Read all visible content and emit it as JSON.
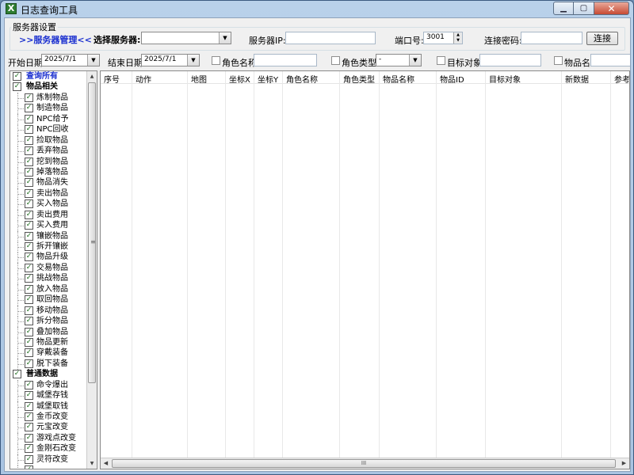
{
  "window": {
    "title": "日志查询工具",
    "min": "▁",
    "max": "▢",
    "close": "✕"
  },
  "server_settings": {
    "group_title": "服务器设置",
    "manage_link": ">>服务器管理<<",
    "select_label": "选择服务器:",
    "ip_label": "服务器IP:",
    "port_label": "端口号:",
    "port_value": "3001",
    "password_label": "连接密码:",
    "connect_button": "连接"
  },
  "filters": {
    "start_label": "开始日期:",
    "start_value": "2025/7/1",
    "end_label": "结束日期:",
    "end_value": "2025/7/1",
    "role_name_label": "角色名称",
    "role_type_label": "角色类型",
    "role_type_value": "-",
    "target_label": "目标对象",
    "item_name_label": "物品名"
  },
  "tree": {
    "items": [
      {
        "label": "查询所有",
        "level": "parent",
        "checked": true,
        "selected": true
      },
      {
        "label": "物品相关",
        "level": "parent",
        "checked": true
      },
      {
        "label": "炼制物品",
        "level": "child",
        "checked": true
      },
      {
        "label": "制造物品",
        "level": "child",
        "checked": true
      },
      {
        "label": "NPC给予",
        "level": "child",
        "checked": true
      },
      {
        "label": "NPC回收",
        "level": "child",
        "checked": true
      },
      {
        "label": "捡取物品",
        "level": "child",
        "checked": true
      },
      {
        "label": "丢弃物品",
        "level": "child",
        "checked": true
      },
      {
        "label": "挖到物品",
        "level": "child",
        "checked": true
      },
      {
        "label": "掉落物品",
        "level": "child",
        "checked": true
      },
      {
        "label": "物品消失",
        "level": "child",
        "checked": true
      },
      {
        "label": "卖出物品",
        "level": "child",
        "checked": true
      },
      {
        "label": "买入物品",
        "level": "child",
        "checked": true
      },
      {
        "label": "卖出费用",
        "level": "child",
        "checked": true
      },
      {
        "label": "买入费用",
        "level": "child",
        "checked": true
      },
      {
        "label": "镶嵌物品",
        "level": "child",
        "checked": true
      },
      {
        "label": "拆开镶嵌",
        "level": "child",
        "checked": true
      },
      {
        "label": "物品升级",
        "level": "child",
        "checked": true
      },
      {
        "label": "交易物品",
        "level": "child",
        "checked": true
      },
      {
        "label": "挑战物品",
        "level": "child",
        "checked": true
      },
      {
        "label": "放入物品",
        "level": "child",
        "checked": true
      },
      {
        "label": "取回物品",
        "level": "child",
        "checked": true
      },
      {
        "label": "移动物品",
        "level": "child",
        "checked": true
      },
      {
        "label": "拆分物品",
        "level": "child",
        "checked": true
      },
      {
        "label": "叠加物品",
        "level": "child",
        "checked": true
      },
      {
        "label": "物品更新",
        "level": "child",
        "checked": true
      },
      {
        "label": "穿戴装备",
        "level": "child",
        "checked": true
      },
      {
        "label": "脱下装备",
        "level": "child",
        "checked": true
      },
      {
        "label": "普通数据",
        "level": "parent",
        "checked": true
      },
      {
        "label": "命令爆出",
        "level": "child",
        "checked": true
      },
      {
        "label": "城堡存钱",
        "level": "child",
        "checked": true
      },
      {
        "label": "城堡取钱",
        "level": "child",
        "checked": true
      },
      {
        "label": "金币改变",
        "level": "child",
        "checked": true
      },
      {
        "label": "元宝改变",
        "level": "child",
        "checked": true
      },
      {
        "label": "游戏点改变",
        "level": "child",
        "checked": true
      },
      {
        "label": "金刚石改变",
        "level": "child",
        "checked": true
      },
      {
        "label": "灵符改变",
        "level": "child",
        "checked": true
      },
      {
        "label": "",
        "level": "child",
        "checked": true
      }
    ]
  },
  "grid": {
    "columns": [
      "序号",
      "动作",
      "地图",
      "坐标X",
      "坐标Y",
      "角色名称",
      "角色类型",
      "物品名称",
      "物品ID",
      "目标对象",
      "新数据",
      "参考"
    ],
    "scroll_grip": "III",
    "vgrip": "≡"
  }
}
